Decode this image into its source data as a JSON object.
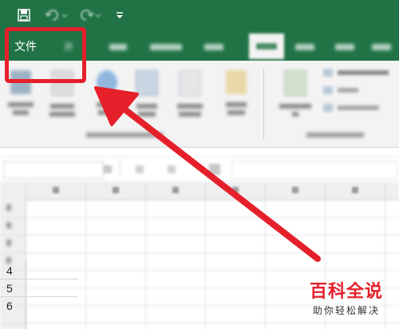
{
  "quick_access": {
    "save_icon": "save-icon",
    "undo_icon": "undo-icon",
    "redo_icon": "redo-icon",
    "customize_icon": "customize-dropdown-icon"
  },
  "tabs": {
    "file_label": "文件",
    "second_label": "开"
  },
  "grid": {
    "row_numbers": [
      "4",
      "5",
      "6"
    ]
  },
  "annotation": {
    "box_color": "#e5202b",
    "arrow_color": "#e5202b"
  },
  "watermark": {
    "title": "百科全说",
    "subtitle": "助你轻松解决"
  },
  "colors": {
    "excel_green": "#217346",
    "ribbon_bg": "#f3f3f3"
  }
}
